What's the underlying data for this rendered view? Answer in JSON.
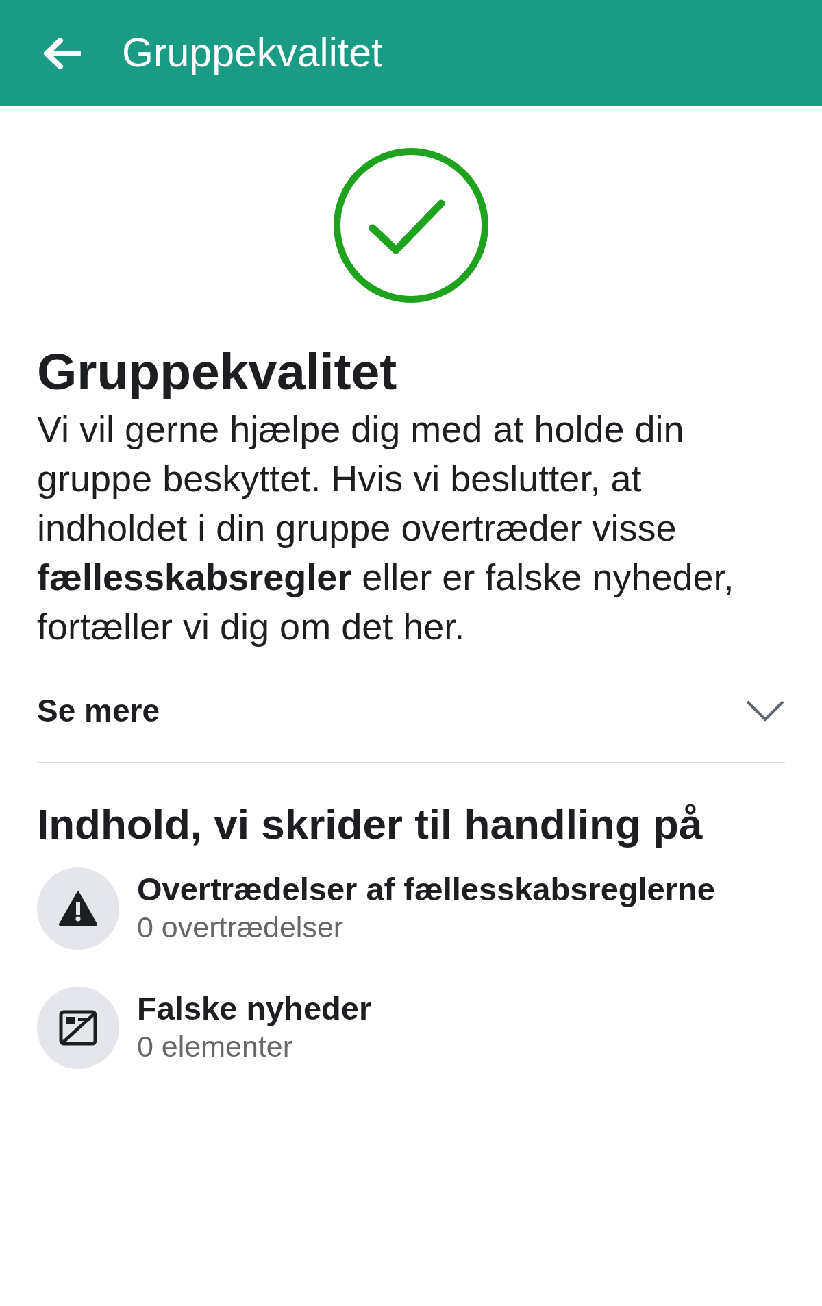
{
  "app_bar": {
    "title": "Gruppekvalitet"
  },
  "status": {
    "ok": true
  },
  "title": "Gruppekvalitet",
  "description": "Vi vil gerne hjælpe dig med at holde din gruppe beskyttet. Hvis vi beslutter, at indholdet i din gruppe overtræder visse **fællesskabsregler** eller er falske nyheder, fortæller vi dig om det her.",
  "see_more": {
    "label": "Se mere",
    "expanded": false
  },
  "section_title": "Indhold, vi skrider til handling på",
  "items": [
    {
      "kind": "warning",
      "title": "Overtrædelser af fællesskabsreglerne",
      "count": "0 overtrædelser"
    },
    {
      "kind": "news",
      "title": "Falske nyheder",
      "count": "0 elementer"
    }
  ]
}
